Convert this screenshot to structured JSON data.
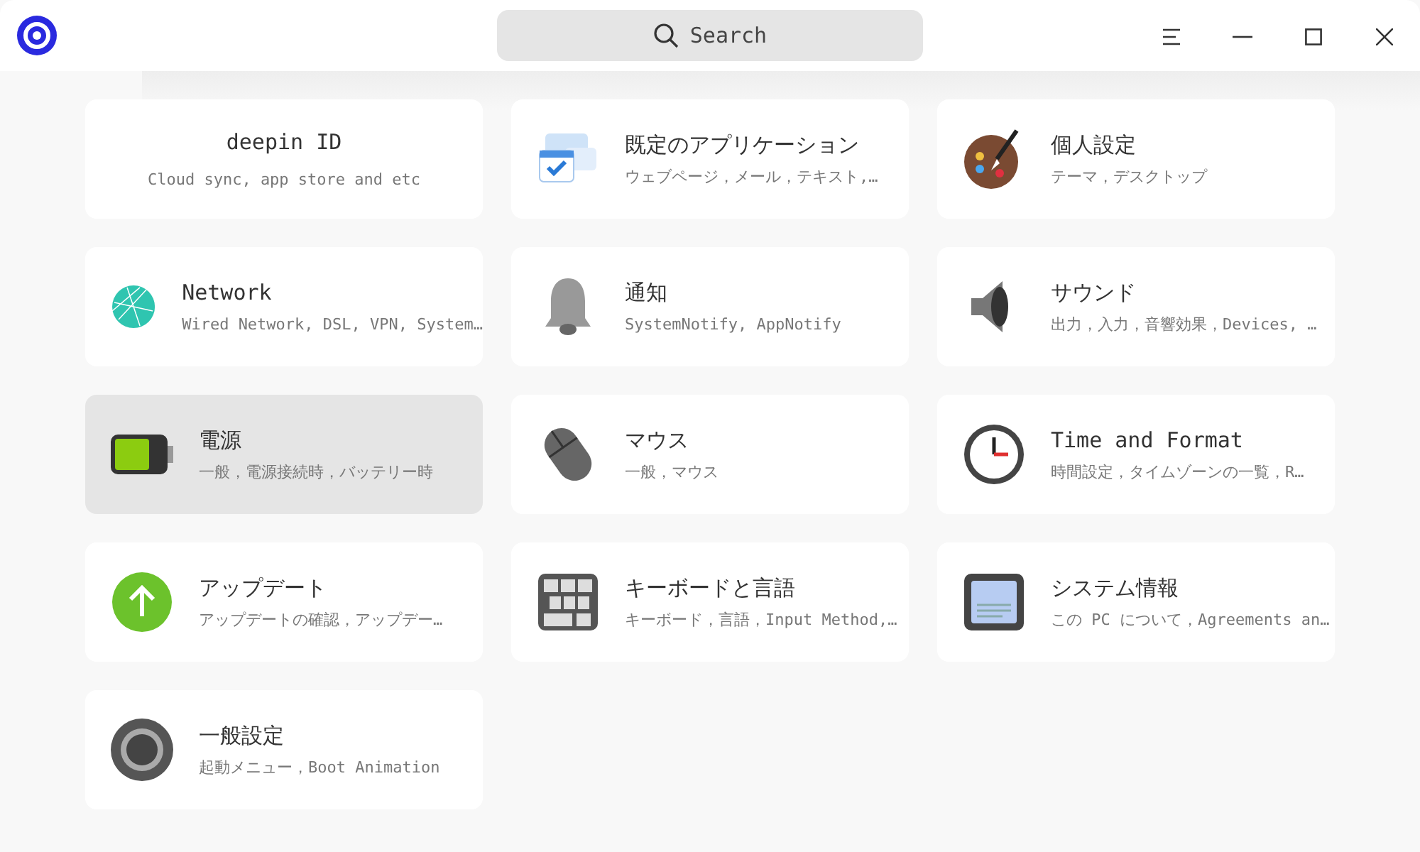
{
  "search": {
    "placeholder": "Search"
  },
  "modules": [
    {
      "kind": "account",
      "title": "deepin ID",
      "subtitle": "Cloud sync, app store and etc",
      "selected": false
    },
    {
      "kind": "module",
      "title": "既定のアプリケーション",
      "subtitle": "ウェブページ，メール，テキスト,…",
      "selected": false
    },
    {
      "kind": "module",
      "title": "個人設定",
      "subtitle": "テーマ，デスクトップ",
      "selected": false
    },
    {
      "kind": "module",
      "title": "Network",
      "subtitle": "Wired Network, DSL, VPN, System…",
      "selected": false
    },
    {
      "kind": "module",
      "title": "通知",
      "subtitle": "SystemNotify, AppNotify",
      "selected": false
    },
    {
      "kind": "module",
      "title": "サウンド",
      "subtitle": "出力，入力，音響効果，Devices, …",
      "selected": false
    },
    {
      "kind": "module",
      "title": "電源",
      "subtitle": "一般，電源接続時，バッテリー時",
      "selected": true
    },
    {
      "kind": "module",
      "title": "マウス",
      "subtitle": "一般，マウス",
      "selected": false
    },
    {
      "kind": "module",
      "title": "Time and Format",
      "subtitle": "時間設定，タイムゾーンの一覧，R…",
      "selected": false
    },
    {
      "kind": "module",
      "title": "アップデート",
      "subtitle": "アップデートの確認，アップデー…",
      "selected": false
    },
    {
      "kind": "module",
      "title": "キーボードと言語",
      "subtitle": "キーボード，言語，Input Method,…",
      "selected": false
    },
    {
      "kind": "module",
      "title": "システム情報",
      "subtitle": "この PC について，Agreements an…",
      "selected": false
    },
    {
      "kind": "module",
      "title": "一般設定",
      "subtitle": "起動メニュー，Boot Animation",
      "selected": false
    }
  ]
}
